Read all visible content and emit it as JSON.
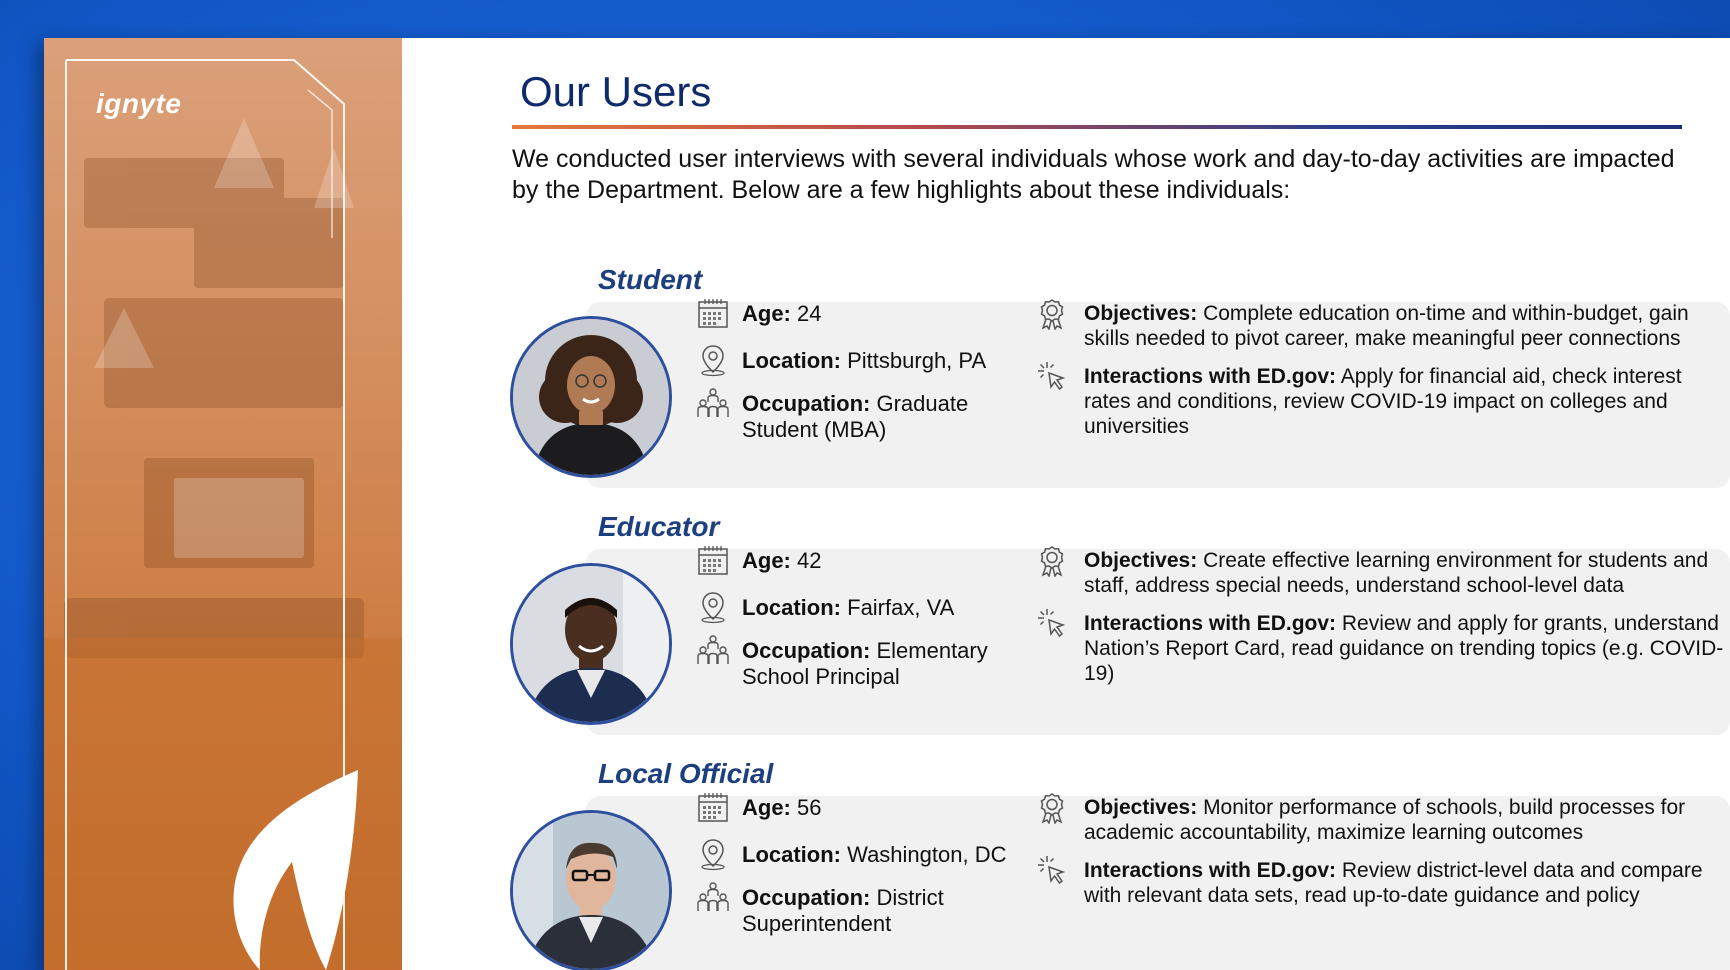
{
  "brand": {
    "logo_text": "ignyte"
  },
  "page": {
    "title": "Our Users",
    "intro": "We conducted user interviews with several individuals whose work and day-to-day activities are impacted by the Department. Below are a few highlights about these individuals:"
  },
  "labels": {
    "age": "Age:",
    "location": "Location:",
    "occupation": "Occupation:",
    "objectives": "Objectives:",
    "interactions": "Interactions with ED.gov:"
  },
  "personas": [
    {
      "name": "Student",
      "age": "24",
      "location": "Pittsburgh, PA",
      "occupation": "Graduate Student (MBA)",
      "objectives": "Complete education on-time and within-budget, gain skills needed to pivot career, make meaningful peer connections",
      "interactions": "Apply for financial aid, check interest rates and conditions, review COVID-19 impact on colleges and universities"
    },
    {
      "name": "Educator",
      "age": "42",
      "location": "Fairfax, VA",
      "occupation": "Elementary School Principal",
      "objectives": "Create effective learning environment for students and staff, address special needs, understand school-level data",
      "interactions": "Review and apply for grants, understand Nation’s Report Card, read guidance on trending topics (e.g. COVID-19)"
    },
    {
      "name": "Local Official",
      "age": "56",
      "location": "Washington, DC",
      "occupation": "District Superintendent",
      "objectives": "Monitor performance of schools, build processes for academic accountability, maximize learning outcomes",
      "interactions": "Review district-level data and compare with relevant data sets, read up-to-date guidance and policy"
    }
  ],
  "icons": {
    "age": "calendar-icon",
    "location": "location-pin-icon",
    "occupation": "people-group-icon",
    "objectives": "award-ribbon-icon",
    "interactions": "cursor-click-icon"
  },
  "colors": {
    "title": "#0f2a6b",
    "persona_name": "#1e3f7e",
    "card_bg": "#f1f1f1",
    "avatar_border": "#2d4f9e",
    "sidebar_orange": "#cc7a3e",
    "backdrop_blue": "#1258c8"
  }
}
